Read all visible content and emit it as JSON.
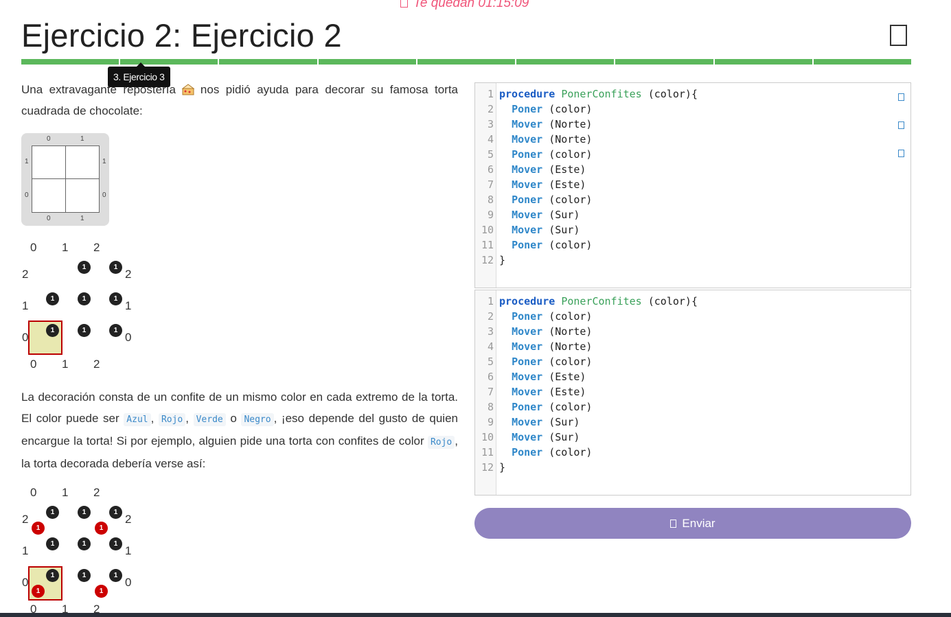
{
  "timer": {
    "text": "Te quedan 01:15:09"
  },
  "header": {
    "title": "Ejercicio 2: Ejercicio 2"
  },
  "progress": {
    "segments": 9,
    "color": "#5cb85c"
  },
  "tooltip": {
    "text": "3. Ejercicio 3"
  },
  "statement": {
    "intro_a": "Una extravagante repostería",
    "intro_b": "nos pidió ayuda para decorar su famosa torta cuadrada de chocolate:",
    "deco_1": "La decoración consta de un confite de un mismo color en cada extremo de la torta. El color puede ser",
    "color_azul": "Azul",
    "color_rojo": "Rojo",
    "color_verde": "Verde",
    "conj_o": "o",
    "color_negro": "Negro",
    "deco_2": ", ¡eso depende del gusto de quien encargue la torta! Si por ejemplo, alguien pide una torta con confites de color",
    "color_rojo_2": "Rojo",
    "deco_3": ", la torta decorada debería verse así:"
  },
  "mini_board": {
    "cols": [
      "0",
      "1"
    ],
    "rows": [
      "1",
      "0"
    ]
  },
  "board_labels": {
    "c0": "0",
    "c1": "1",
    "c2": "2",
    "r0": "0",
    "r1": "1",
    "r2": "2"
  },
  "ball_count": "1",
  "editor_top": {
    "lines": [
      {
        "n": "1",
        "kw": "procedure",
        "fn": "PonerConfites",
        "rest": " (color){"
      },
      {
        "n": "2",
        "cmd": "Poner",
        "rest": " (color)"
      },
      {
        "n": "3",
        "cmd": "Mover",
        "rest": " (Norte)"
      },
      {
        "n": "4",
        "cmd": "Mover",
        "rest": " (Norte)"
      },
      {
        "n": "5",
        "cmd": "Poner",
        "rest": " (color)"
      },
      {
        "n": "6",
        "cmd": "Mover",
        "rest": " (Este)"
      },
      {
        "n": "7",
        "cmd": "Mover",
        "rest": " (Este)"
      },
      {
        "n": "8",
        "cmd": "Poner",
        "rest": " (color)"
      },
      {
        "n": "9",
        "cmd": "Mover",
        "rest": " (Sur)"
      },
      {
        "n": "10",
        "cmd": "Mover",
        "rest": " (Sur)"
      },
      {
        "n": "11",
        "cmd": "Poner",
        "rest": " (color)"
      },
      {
        "n": "12",
        "rest": "}"
      }
    ]
  },
  "editor_bottom": {
    "lines": [
      {
        "n": "1",
        "kw": "procedure",
        "fn": "PonerConfites",
        "rest": " (color){"
      },
      {
        "n": "2",
        "cmd": "Poner",
        "rest": " (color)"
      },
      {
        "n": "3",
        "cmd": "Mover",
        "rest": " (Norte)"
      },
      {
        "n": "4",
        "cmd": "Mover",
        "rest": " (Norte)"
      },
      {
        "n": "5",
        "cmd": "Poner",
        "rest": " (color)"
      },
      {
        "n": "6",
        "cmd": "Mover",
        "rest": " (Este)"
      },
      {
        "n": "7",
        "cmd": "Mover",
        "rest": " (Este)"
      },
      {
        "n": "8",
        "cmd": "Poner",
        "rest": " (color)"
      },
      {
        "n": "9",
        "cmd": "Mover",
        "rest": " (Sur)"
      },
      {
        "n": "10",
        "cmd": "Mover",
        "rest": " (Sur)"
      },
      {
        "n": "11",
        "cmd": "Poner",
        "rest": " (color)"
      },
      {
        "n": "12",
        "rest": "}"
      }
    ]
  },
  "actions": {
    "send_label": "Enviar"
  },
  "icons": {
    "timer": "clock-icon",
    "fullscreen": "expand-icon",
    "send": "paper-plane-icon",
    "editor_side": [
      "reset-icon",
      "fullscreen-icon",
      "help-icon"
    ]
  }
}
